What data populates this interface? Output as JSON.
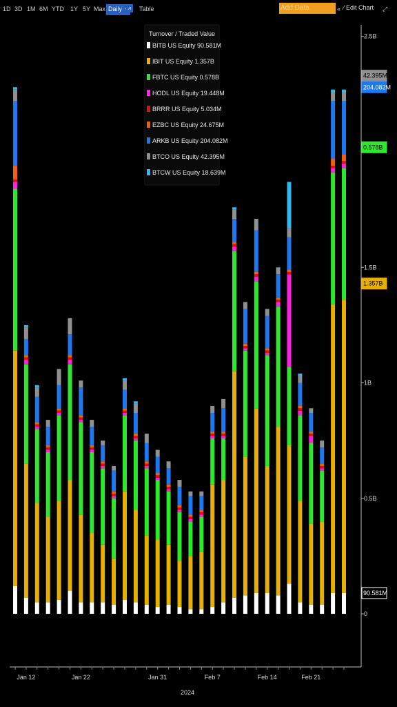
{
  "toolbar": {
    "ranges": [
      "1D",
      "3D",
      "1M",
      "6M",
      "YTD",
      "1Y",
      "5Y",
      "Max"
    ],
    "interval": "Daily",
    "interval_caret": "▼",
    "chart_icon": "line-chart-icon",
    "table_label": "Table",
    "add_data_placeholder": "Add Data",
    "collapse_icon": "double-chevron-left-icon",
    "edit_chart_label": "Edit Chart",
    "expand_icon": "expand-arrow-icon"
  },
  "chart_data": {
    "type": "bar",
    "stacked": true,
    "title": "Turnover / Traded Value",
    "x_axis_label": "2024",
    "x_tick_labels": [
      "Jan 12",
      "Jan 22",
      "Jan 31",
      "Feb 7",
      "Feb 14",
      "Feb 21"
    ],
    "x_tick_index": [
      1,
      6,
      13,
      18,
      23,
      27
    ],
    "y_ticks": [
      "0",
      "0.5B",
      "1B",
      "1.5B",
      "2.5B"
    ],
    "y_tick_values": [
      0,
      0.5,
      1,
      1.5,
      2.5
    ],
    "ylim": [
      -0.23,
      2.55
    ],
    "y_units": "B",
    "legend_position": "top-center",
    "series": [
      {
        "name": "BITB US Equity",
        "last": "90.581M",
        "color": "#ffffff",
        "values": [
          0.12,
          0.07,
          0.05,
          0.05,
          0.06,
          0.1,
          0.05,
          0.05,
          0.05,
          0.04,
          0.06,
          0.05,
          0.04,
          0.03,
          0.04,
          0.03,
          0.02,
          0.02,
          0.03,
          0.05,
          0.07,
          0.08,
          0.09,
          0.09,
          0.08,
          0.13,
          0.05,
          0.04,
          0.04,
          0.09,
          0.09
        ]
      },
      {
        "name": "IBIT US Equity",
        "last": "1.357B",
        "color": "#e6b000",
        "values": [
          1.02,
          0.58,
          0.43,
          0.37,
          0.43,
          0.48,
          0.38,
          0.3,
          0.25,
          0.2,
          0.47,
          0.4,
          0.3,
          0.29,
          0.26,
          0.2,
          0.23,
          0.25,
          0.53,
          0.53,
          0.98,
          0.6,
          0.8,
          0.55,
          0.73,
          0.6,
          0.44,
          0.35,
          0.36,
          1.25,
          1.27
        ]
      },
      {
        "name": "FBTC US Equity",
        "last": "0.578B",
        "color": "#2ee82e",
        "values": [
          0.7,
          0.43,
          0.32,
          0.28,
          0.37,
          0.5,
          0.4,
          0.35,
          0.33,
          0.26,
          0.33,
          0.3,
          0.29,
          0.26,
          0.23,
          0.21,
          0.15,
          0.15,
          0.2,
          0.18,
          0.52,
          0.46,
          0.55,
          0.48,
          0.52,
          0.34,
          0.37,
          0.35,
          0.22,
          0.57,
          0.57
        ]
      },
      {
        "name": "HODL US Equity",
        "last": "19.448M",
        "color": "#ff20e0",
        "values": [
          0.03,
          0.02,
          0.01,
          0.01,
          0.01,
          0.02,
          0.01,
          0.01,
          0.01,
          0.01,
          0.01,
          0.01,
          0.01,
          0.01,
          0.01,
          0.01,
          0.01,
          0.01,
          0.01,
          0.01,
          0.02,
          0.01,
          0.02,
          0.01,
          0.02,
          0.4,
          0.02,
          0.03,
          0.01,
          0.02,
          0.02
        ]
      },
      {
        "name": "BRRR US Equity",
        "last": "5.034M",
        "color": "#e01010",
        "values": [
          0.01,
          0.01,
          0.01,
          0.01,
          0.01,
          0.01,
          0.01,
          0.01,
          0.01,
          0.01,
          0.01,
          0.01,
          0.01,
          0.01,
          0.01,
          0.01,
          0.01,
          0.01,
          0.01,
          0.01,
          0.01,
          0.01,
          0.01,
          0.01,
          0.01,
          0.01,
          0.01,
          0.01,
          0.01,
          0.01,
          0.01
        ]
      },
      {
        "name": "EZBC US Equity",
        "last": "24.675M",
        "color": "#f06010",
        "values": [
          0.06,
          0.01,
          0.01,
          0.01,
          0.01,
          0.01,
          0.01,
          0.01,
          0.01,
          0.01,
          0.01,
          0.01,
          0.01,
          0.01,
          0.01,
          0.01,
          0.01,
          0.01,
          0.01,
          0.01,
          0.01,
          0.01,
          0.01,
          0.01,
          0.01,
          0.01,
          0.01,
          0.01,
          0.01,
          0.03,
          0.03
        ]
      },
      {
        "name": "ARKB US Equity",
        "last": "204.082M",
        "color": "#1e78f0",
        "values": [
          0.28,
          0.07,
          0.11,
          0.08,
          0.1,
          0.09,
          0.12,
          0.08,
          0.07,
          0.09,
          0.08,
          0.09,
          0.08,
          0.07,
          0.07,
          0.08,
          0.08,
          0.06,
          0.08,
          0.1,
          0.1,
          0.15,
          0.18,
          0.14,
          0.1,
          0.14,
          0.1,
          0.08,
          0.07,
          0.25,
          0.23
        ]
      },
      {
        "name": "BTCO US Equity",
        "last": "42.395M",
        "color": "#909090",
        "values": [
          0.05,
          0.05,
          0.04,
          0.03,
          0.07,
          0.07,
          0.03,
          0.03,
          0.02,
          0.02,
          0.04,
          0.04,
          0.04,
          0.03,
          0.03,
          0.03,
          0.02,
          0.02,
          0.03,
          0.04,
          0.04,
          0.03,
          0.05,
          0.03,
          0.03,
          0.04,
          0.03,
          0.02,
          0.03,
          0.04,
          0.04
        ]
      },
      {
        "name": "BTCW US Equity",
        "last": "18.639M",
        "color": "#30b8f0",
        "values": [
          0.01,
          0.01,
          0.01,
          0.0,
          0.0,
          0.0,
          0.0,
          0.0,
          0.0,
          0.0,
          0.01,
          0.01,
          0.0,
          0.0,
          0.0,
          0.0,
          0.0,
          0.0,
          0.0,
          0.0,
          0.01,
          0.0,
          0.0,
          0.0,
          0.0,
          0.2,
          0.01,
          0.0,
          0.0,
          0.01,
          0.01
        ]
      }
    ],
    "last_value_tags": [
      {
        "label": "90.581M",
        "series": "BITB US Equity",
        "value": 0.09,
        "bg": "#000000",
        "fg": "#ffffff",
        "border": "#ffffff"
      },
      {
        "label": "1.357B",
        "series": "IBIT US Equity",
        "value": 1.43,
        "bg": "#e6b000",
        "fg": "#000000",
        "border": "#e6b000"
      },
      {
        "label": "0.578B",
        "series": "FBTC US Equity",
        "value": 2.02,
        "bg": "#2ee82e",
        "fg": "#000000",
        "border": "#2ee82e"
      },
      {
        "label": "204.082M",
        "series": "ARKB US Equity",
        "value": 2.28,
        "bg": "#1e78f0",
        "fg": "#ffffff",
        "border": "#1e78f0"
      },
      {
        "label": "42.395M",
        "series": "BTCO US Equity",
        "value": 2.33,
        "bg": "#909090",
        "fg": "#000000",
        "border": "#909090"
      }
    ]
  }
}
